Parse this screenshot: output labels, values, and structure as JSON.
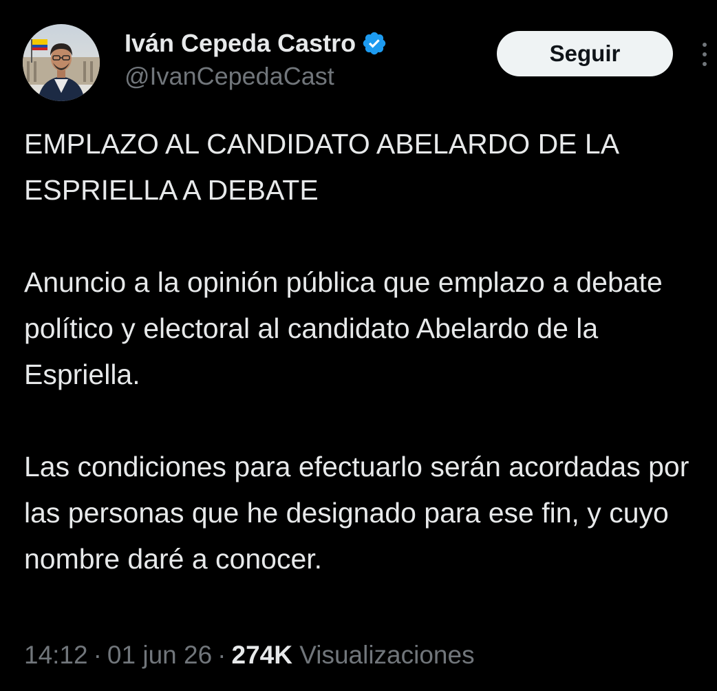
{
  "author": {
    "display_name": "Iván Cepeda Castro",
    "handle": "@IvanCepedaCast",
    "verified": true,
    "verified_color": "#1d9bf0"
  },
  "follow_button": {
    "label": "Seguir"
  },
  "more_menu": {
    "icon": "more-vertical-icon"
  },
  "tweet": {
    "paragraphs": [
      "EMPLAZO AL CANDIDATO ABELARDO DE LA ESPRIELLA A DEBATE",
      "Anuncio a la opinión pública que emplazo a debate político y electoral al candidato Abelardo de la Espriella.",
      "Las condiciones para efectuarlo serán acordadas por las personas que he designado para ese fin, y cuyo nombre daré a conocer."
    ]
  },
  "meta": {
    "time": "14:12",
    "date": "01 jun 26",
    "separator": "·",
    "views_count": "274K",
    "views_label": "Visualizaciones"
  },
  "colors": {
    "background": "#000000",
    "text_primary": "#e7e9ea",
    "text_secondary": "#71767b",
    "button_bg": "#eff3f4",
    "button_text": "#0f1419"
  }
}
